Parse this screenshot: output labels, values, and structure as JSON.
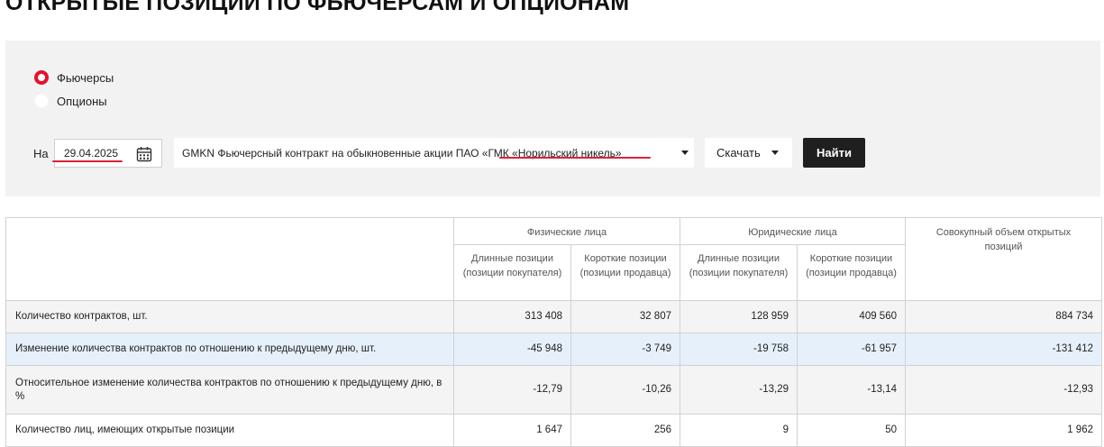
{
  "page": {
    "title": "ОТКРЫТЫЕ ПОЗИЦИИ ПО ФЬЮЧЕРСАМ И ОПЦИОНАМ"
  },
  "filters": {
    "instrument_type": {
      "options": [
        "Фьючерсы",
        "Опционы"
      ],
      "selected": "Фьючерсы"
    },
    "date_label": "На",
    "date_value": "29.04.2025",
    "contract": "GMKN Фьючерсный контракт на обыкновенные акции ПАО «ГМК «Норильский никель»",
    "download_label": "Скачать",
    "find_label": "Найти",
    "accent_color": "#e3122d"
  },
  "table": {
    "groups": [
      "Физические лица",
      "Юридические лица",
      "Совокупный объем открытых позиций"
    ],
    "subheaders": [
      "Длинные позиции (позиции покупателя)",
      "Короткие позиции (позиции продавца)",
      "Длинные позиции (позиции покупателя)",
      "Короткие позиции (позиции продавца)"
    ],
    "rows": [
      {
        "label": "Количество контрактов, шт.",
        "values": [
          "313 408",
          "32 807",
          "128 959",
          "409 560",
          "884 734"
        ]
      },
      {
        "label": "Изменение количества контрактов по отношению к предыдущему дню, шт.",
        "values": [
          "-45 948",
          "-3 749",
          "-19 758",
          "-61 957",
          "-131 412"
        ]
      },
      {
        "label": "Относительное изменение количества контрактов по отношению к предыдущему дню, в %",
        "values": [
          "-12,79",
          "-10,26",
          "-13,29",
          "-13,14",
          "-12,93"
        ]
      },
      {
        "label": "Количество лиц, имеющих открытые позиции",
        "values": [
          "1 647",
          "256",
          "9",
          "50",
          "1 962"
        ]
      }
    ]
  }
}
